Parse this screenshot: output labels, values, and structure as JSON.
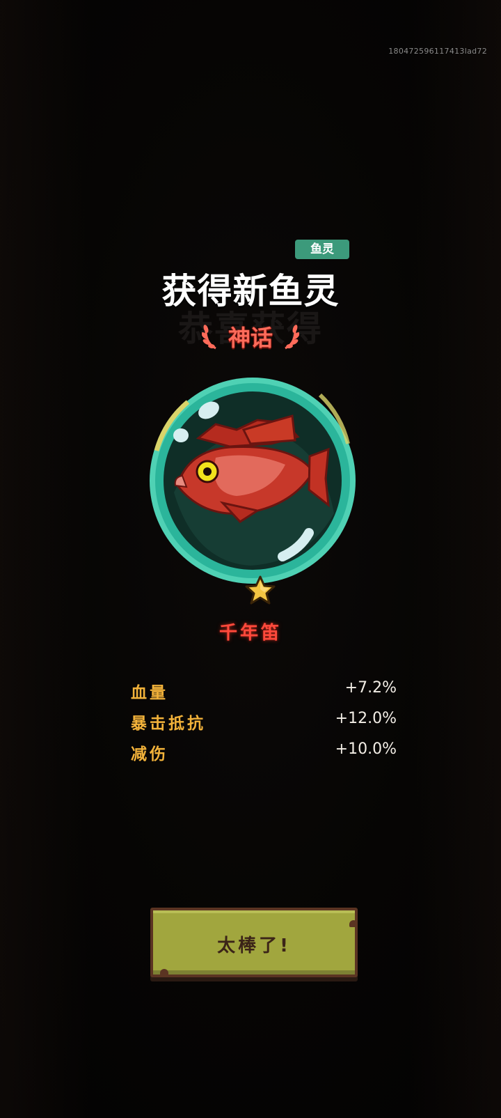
{
  "session_id": "180472596117413lad72",
  "category_tag": "鱼灵",
  "title": "获得新鱼灵",
  "ghost_title": "恭喜获得",
  "rarity": "神话",
  "fish": {
    "name": "千年笛",
    "stars": 1
  },
  "stats": [
    {
      "name": "血量",
      "value": "+7.2%"
    },
    {
      "name": "暴击抵抗",
      "value": "+12.0%"
    },
    {
      "name": "减伤",
      "value": "+10.0%"
    }
  ],
  "confirm_button": "太棒了!",
  "colors": {
    "tag_bg": "#3c9a7b",
    "rarity": "#ff6b5a",
    "fish_name": "#ff4a3c",
    "stat_name": "#f2b23a",
    "button_bg": "#a1a63e"
  }
}
